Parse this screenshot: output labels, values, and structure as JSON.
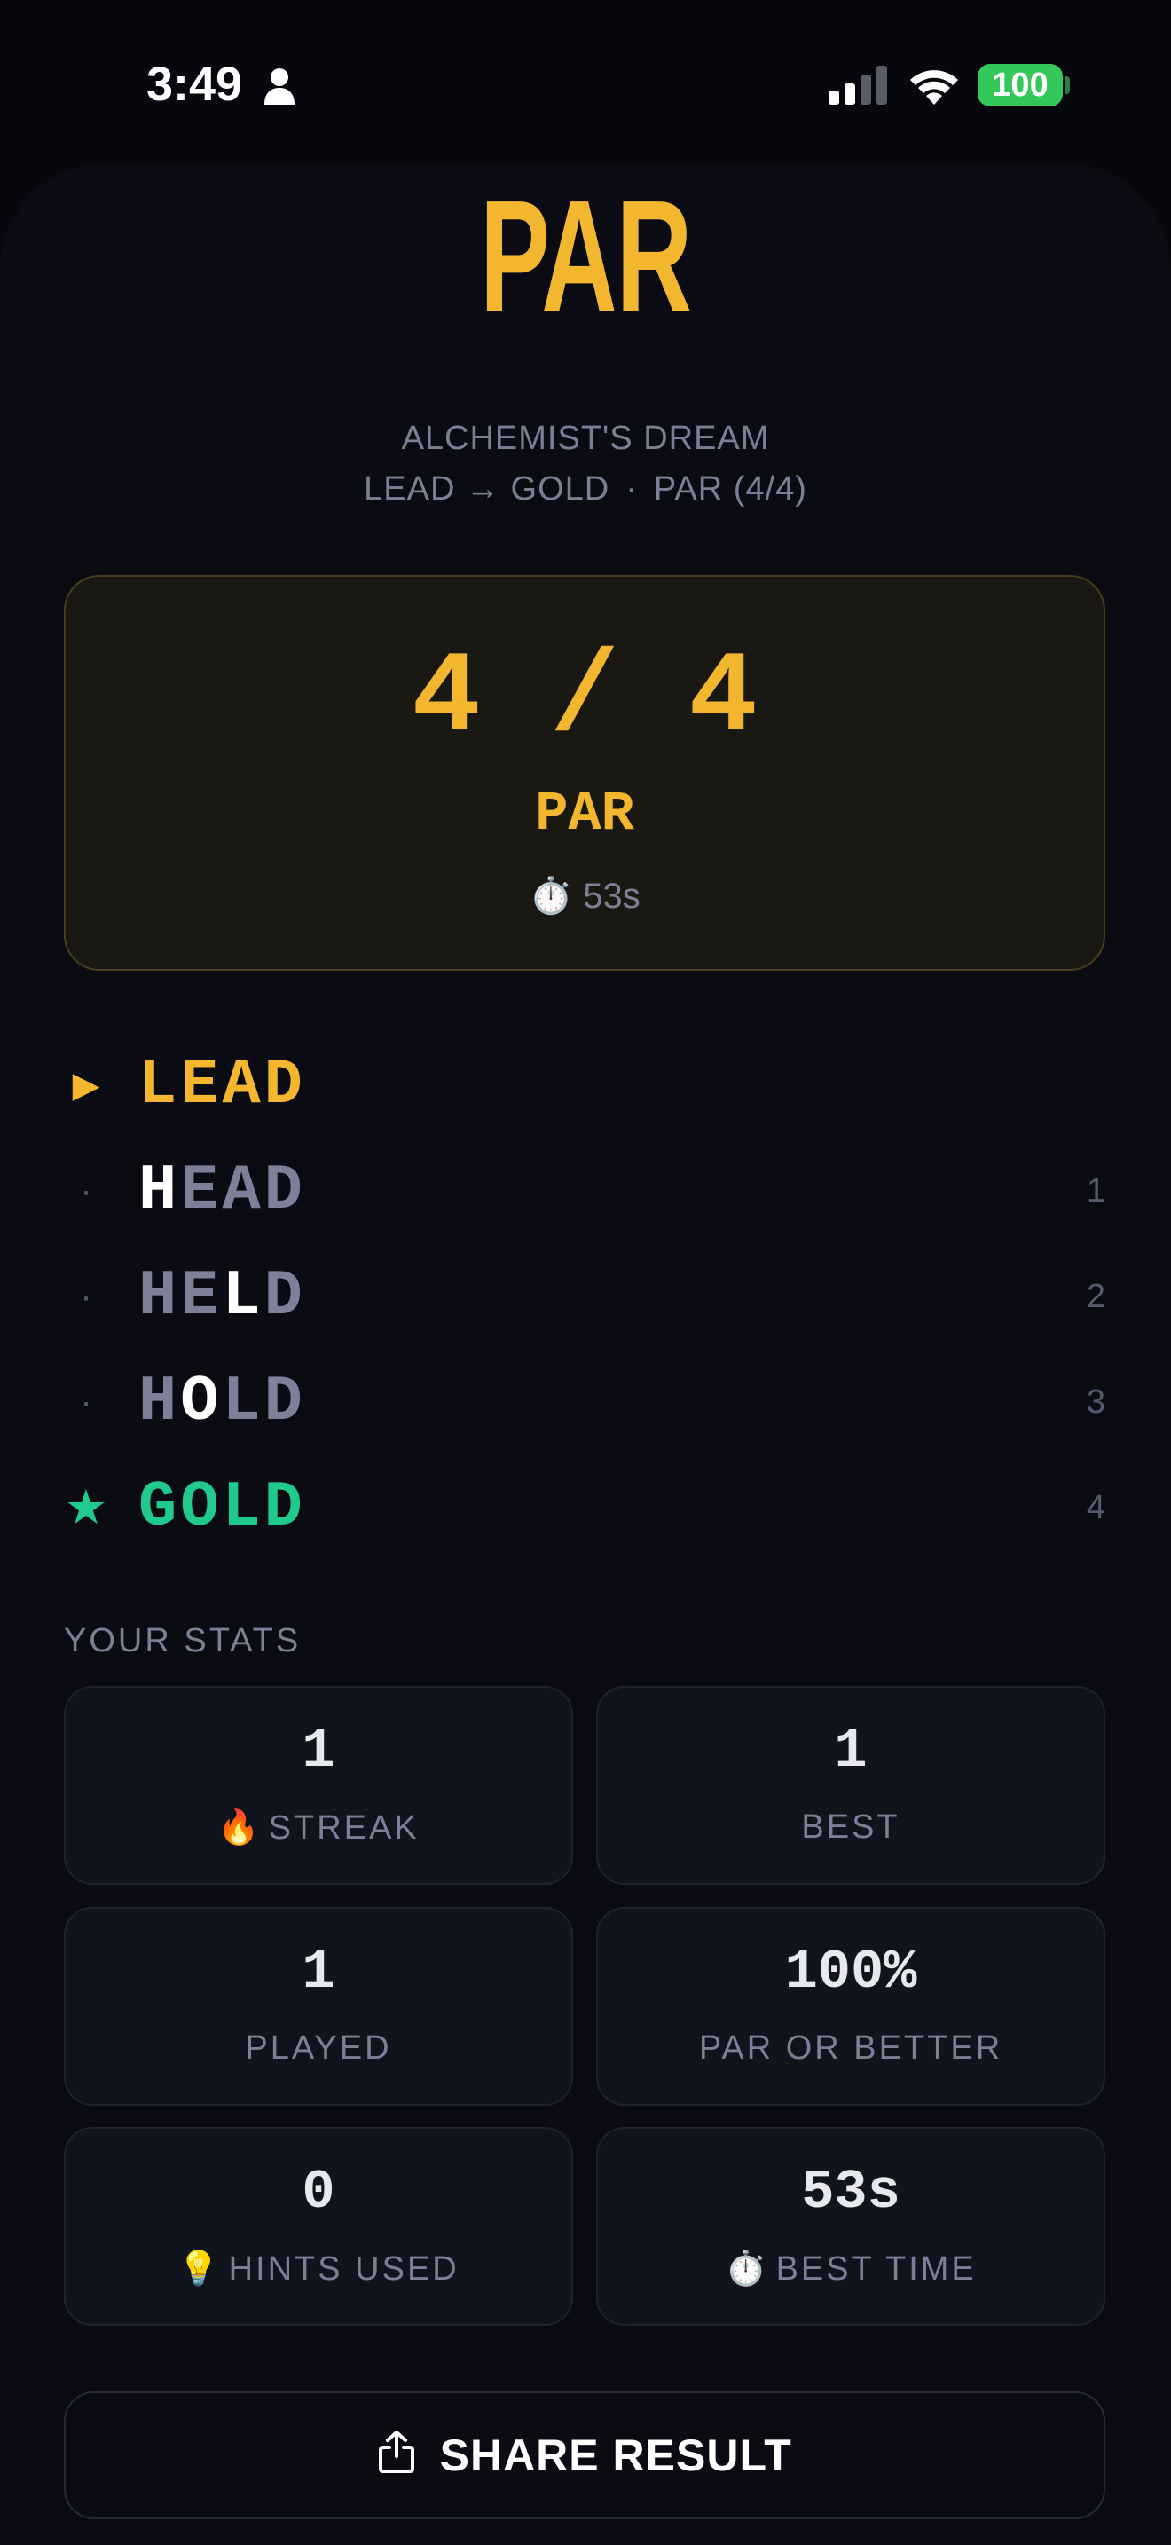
{
  "status_bar": {
    "time": "3:49",
    "battery": "100",
    "icons": [
      "person-icon",
      "signal-icon",
      "wifi-icon",
      "battery-icon"
    ]
  },
  "app": {
    "title": "PAR",
    "accent_color": "#f2b72f",
    "success_color": "#20c98e"
  },
  "puzzle": {
    "name": "ALCHEMIST'S DREAM",
    "route": "LEAD → GOLD",
    "separator": "·",
    "par_info": "PAR (4/4)"
  },
  "result": {
    "score": "4 / 4",
    "label": "PAR",
    "time_icon": "stopwatch-icon",
    "time_emoji": "⏱️",
    "time": "53s"
  },
  "ladder": [
    {
      "marker": "▶",
      "letters": [
        "L",
        "E",
        "A",
        "D"
      ],
      "changed": -1,
      "step": ""
    },
    {
      "marker": "·",
      "letters": [
        "H",
        "E",
        "A",
        "D"
      ],
      "changed": 0,
      "step": "1"
    },
    {
      "marker": "·",
      "letters": [
        "H",
        "E",
        "L",
        "D"
      ],
      "changed": 2,
      "step": "2"
    },
    {
      "marker": "·",
      "letters": [
        "H",
        "O",
        "L",
        "D"
      ],
      "changed": 1,
      "step": "3"
    },
    {
      "marker": "★",
      "letters": [
        "G",
        "O",
        "L",
        "D"
      ],
      "changed": -1,
      "step": "4"
    }
  ],
  "stats": {
    "heading": "YOUR STATS",
    "items": [
      {
        "value": "1",
        "icon": "fire-icon",
        "emoji": "🔥",
        "label": "STREAK"
      },
      {
        "value": "1",
        "icon": "",
        "emoji": "",
        "label": "BEST"
      },
      {
        "value": "1",
        "icon": "",
        "emoji": "",
        "label": "PLAYED"
      },
      {
        "value": "100%",
        "icon": "",
        "emoji": "",
        "label": "PAR OR BETTER"
      },
      {
        "value": "0",
        "icon": "lightbulb-icon",
        "emoji": "💡",
        "label": "HINTS USED"
      },
      {
        "value": "53s",
        "icon": "stopwatch-icon",
        "emoji": "⏱️",
        "label": "BEST TIME"
      }
    ]
  },
  "share": {
    "label": "SHARE RESULT",
    "icon": "share-icon"
  }
}
